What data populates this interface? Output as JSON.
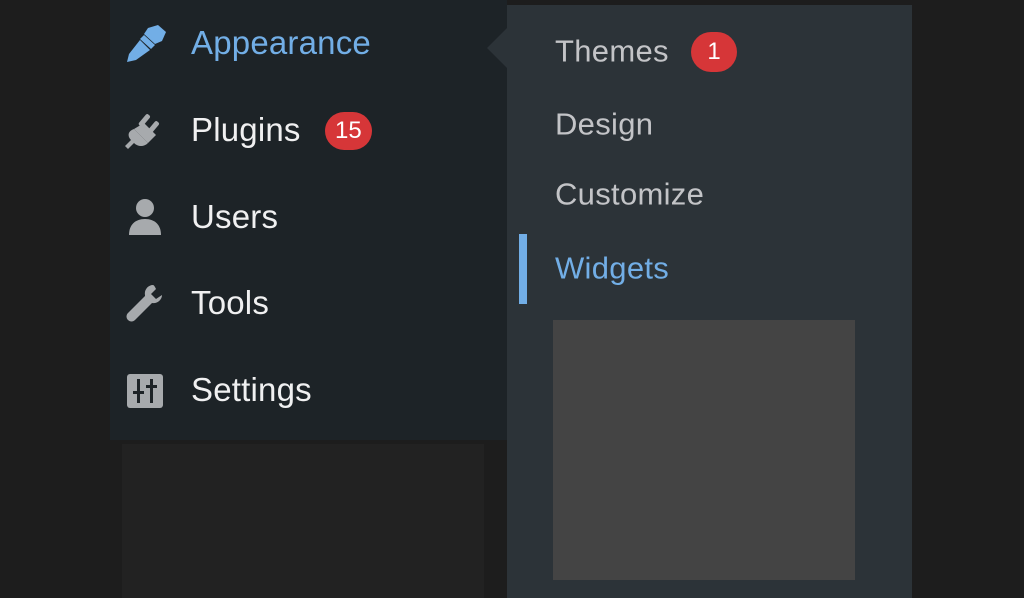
{
  "menu": {
    "items": [
      {
        "label": "Appearance",
        "icon": "paintbrush-icon",
        "current": true
      },
      {
        "label": "Plugins",
        "icon": "plug-icon",
        "badge": "15"
      },
      {
        "label": "Users",
        "icon": "user-icon"
      },
      {
        "label": "Tools",
        "icon": "wrench-icon"
      },
      {
        "label": "Settings",
        "icon": "sliders-icon"
      }
    ]
  },
  "submenu": {
    "items": [
      {
        "label": "Themes",
        "badge": "1"
      },
      {
        "label": "Design"
      },
      {
        "label": "Customize"
      },
      {
        "label": "Widgets",
        "current": true
      }
    ]
  },
  "colors": {
    "menu_bg": "#1d2327",
    "submenu_bg": "#2c3338",
    "accent": "#72aee6",
    "badge": "#d63638",
    "menu_text": "#f0f0f1",
    "submenu_text": "#c3c4c7"
  }
}
